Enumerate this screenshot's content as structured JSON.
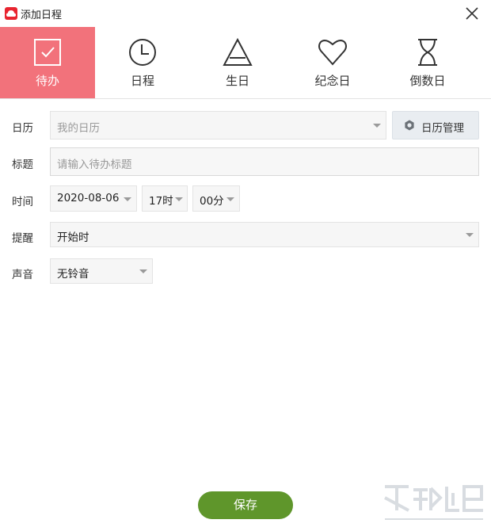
{
  "window": {
    "title": "添加日程"
  },
  "tabs": [
    {
      "label": "待办",
      "icon": "checkbox-icon",
      "active": true
    },
    {
      "label": "日程",
      "icon": "clock-icon",
      "active": false
    },
    {
      "label": "生日",
      "icon": "triangle-icon",
      "active": false
    },
    {
      "label": "纪念日",
      "icon": "heart-icon",
      "active": false
    },
    {
      "label": "倒数日",
      "icon": "hourglass-icon",
      "active": false
    }
  ],
  "form": {
    "calendar": {
      "label": "日历",
      "value": "我的日历",
      "manage_label": "日历管理"
    },
    "title": {
      "label": "标题",
      "placeholder": "请输入待办标题"
    },
    "time": {
      "label": "时间",
      "date": "2020-08-06",
      "hour": "17时",
      "minute": "00分"
    },
    "reminder": {
      "label": "提醒",
      "value": "开始时"
    },
    "sound": {
      "label": "声音",
      "value": "无铃音"
    }
  },
  "actions": {
    "save_label": "保存"
  },
  "colors": {
    "active_tab": "#f2727b",
    "save_button": "#5f962b",
    "logo": "#e8242f"
  }
}
